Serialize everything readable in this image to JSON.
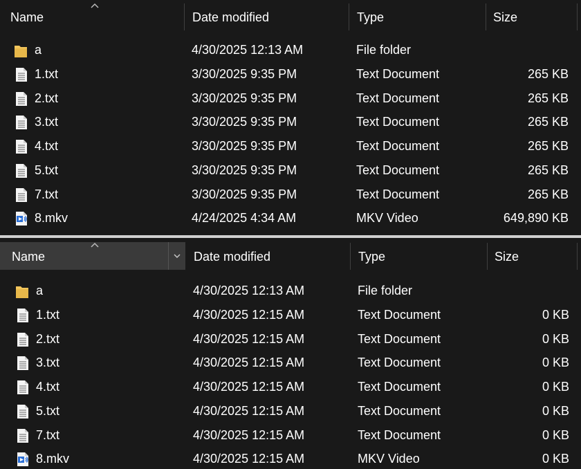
{
  "columns": {
    "name": "Name",
    "date": "Date modified",
    "type": "Type",
    "size": "Size"
  },
  "top_pane": {
    "rows": [
      {
        "name": "a",
        "icon": "folder-icon",
        "date": "4/30/2025 12:13 AM",
        "type": "File folder",
        "size": ""
      },
      {
        "name": "1.txt",
        "icon": "text-file-icon",
        "date": "3/30/2025 9:35 PM",
        "type": "Text Document",
        "size": "265 KB"
      },
      {
        "name": "2.txt",
        "icon": "text-file-icon",
        "date": "3/30/2025 9:35 PM",
        "type": "Text Document",
        "size": "265 KB"
      },
      {
        "name": "3.txt",
        "icon": "text-file-icon",
        "date": "3/30/2025 9:35 PM",
        "type": "Text Document",
        "size": "265 KB"
      },
      {
        "name": "4.txt",
        "icon": "text-file-icon",
        "date": "3/30/2025 9:35 PM",
        "type": "Text Document",
        "size": "265 KB"
      },
      {
        "name": "5.txt",
        "icon": "text-file-icon",
        "date": "3/30/2025 9:35 PM",
        "type": "Text Document",
        "size": "265 KB"
      },
      {
        "name": "7.txt",
        "icon": "text-file-icon",
        "date": "3/30/2025 9:35 PM",
        "type": "Text Document",
        "size": "265 KB"
      },
      {
        "name": "8.mkv",
        "icon": "video-file-icon",
        "date": "4/24/2025 4:34 AM",
        "type": "MKV Video",
        "size": "649,890 KB"
      }
    ]
  },
  "bottom_pane": {
    "rows": [
      {
        "name": "a",
        "icon": "folder-icon",
        "date": "4/30/2025 12:13 AM",
        "type": "File folder",
        "size": ""
      },
      {
        "name": "1.txt",
        "icon": "text-file-icon",
        "date": "4/30/2025 12:15 AM",
        "type": "Text Document",
        "size": "0 KB"
      },
      {
        "name": "2.txt",
        "icon": "text-file-icon",
        "date": "4/30/2025 12:15 AM",
        "type": "Text Document",
        "size": "0 KB"
      },
      {
        "name": "3.txt",
        "icon": "text-file-icon",
        "date": "4/30/2025 12:15 AM",
        "type": "Text Document",
        "size": "0 KB"
      },
      {
        "name": "4.txt",
        "icon": "text-file-icon",
        "date": "4/30/2025 12:15 AM",
        "type": "Text Document",
        "size": "0 KB"
      },
      {
        "name": "5.txt",
        "icon": "text-file-icon",
        "date": "4/30/2025 12:15 AM",
        "type": "Text Document",
        "size": "0 KB"
      },
      {
        "name": "7.txt",
        "icon": "text-file-icon",
        "date": "4/30/2025 12:15 AM",
        "type": "Text Document",
        "size": "0 KB"
      },
      {
        "name": "8.mkv",
        "icon": "video-file-icon",
        "date": "4/30/2025 12:15 AM",
        "type": "MKV Video",
        "size": "0 KB"
      }
    ]
  },
  "colors": {
    "background": "#191919",
    "header_highlight": "#3a3a3a",
    "divider": "#cfcfcf",
    "folder": "#f2c55c",
    "video_icon": "#2b6fd6"
  }
}
